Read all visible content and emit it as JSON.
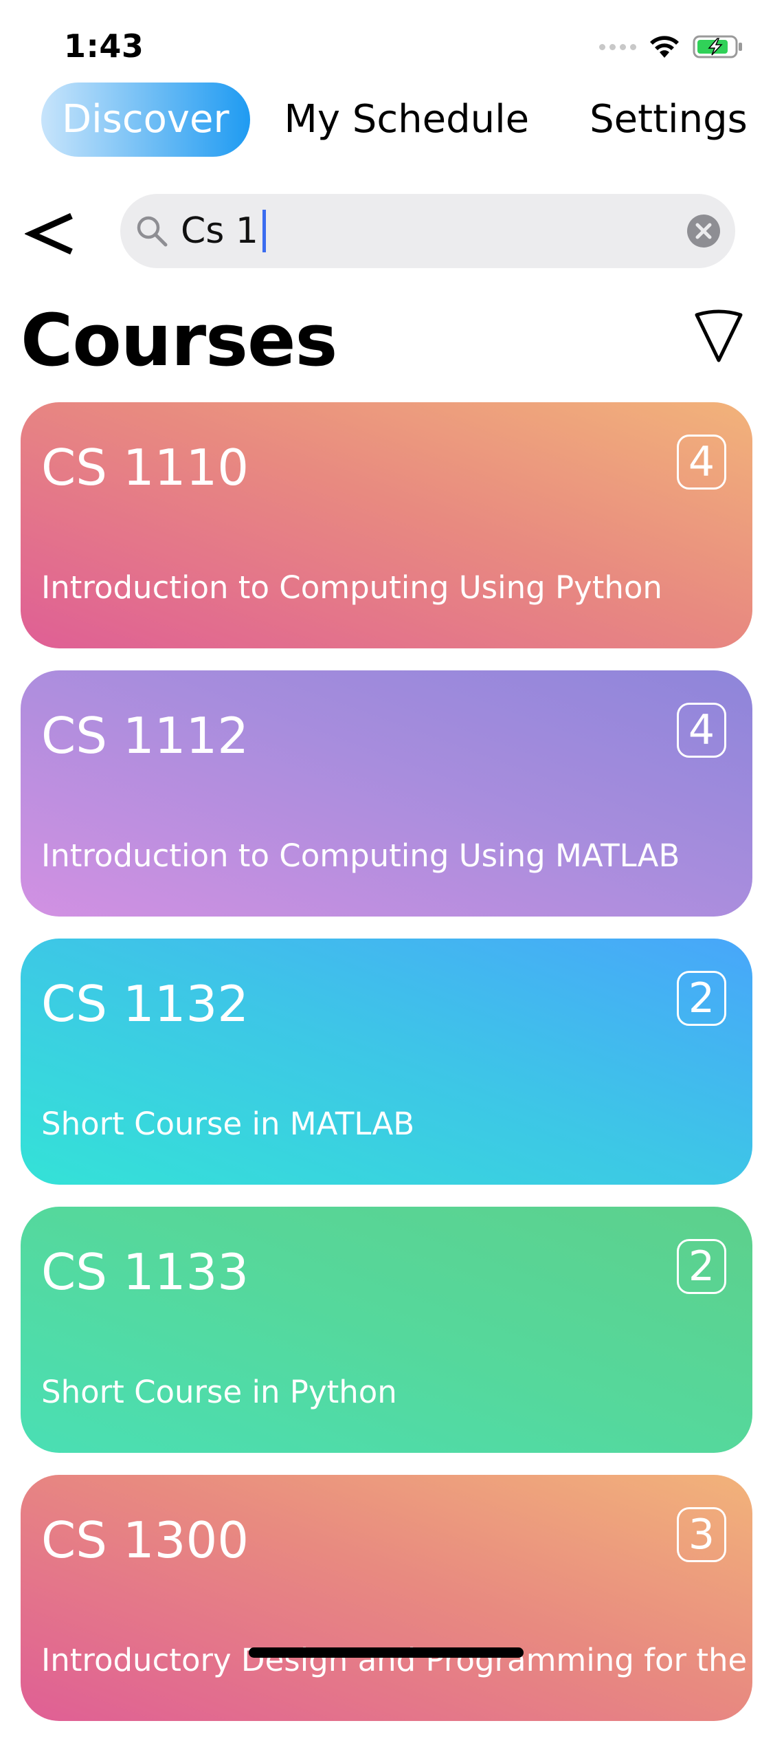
{
  "status_bar": {
    "time": "1:43",
    "icons": [
      "signal-dots-icon",
      "wifi-icon",
      "battery-charging-icon"
    ],
    "battery_color": "#30d158"
  },
  "tabs": [
    {
      "label": "Discover",
      "active": true
    },
    {
      "label": "My Schedule",
      "active": false
    },
    {
      "label": "Settings",
      "active": false
    }
  ],
  "accent_color": "#1f9bf2",
  "search": {
    "value": "Cs 1",
    "icons": [
      "back-chevron-icon",
      "magnifier-icon",
      "clear-icon"
    ]
  },
  "section": {
    "title": "Courses",
    "filter_icon": "filter-triangle-icon"
  },
  "courses": [
    {
      "code": "CS 1110",
      "title": "Introduction to Computing Using Python",
      "credits": "4"
    },
    {
      "code": "CS 1112",
      "title": "Introduction to Computing Using MATLAB",
      "credits": "4"
    },
    {
      "code": "CS 1132",
      "title": "Short Course in MATLAB",
      "credits": "2"
    },
    {
      "code": "CS 1133",
      "title": "Short Course in Python",
      "credits": "2"
    },
    {
      "code": "CS 1300",
      "title": "Introductory Design and Programming for the Web",
      "credits": "3"
    }
  ]
}
